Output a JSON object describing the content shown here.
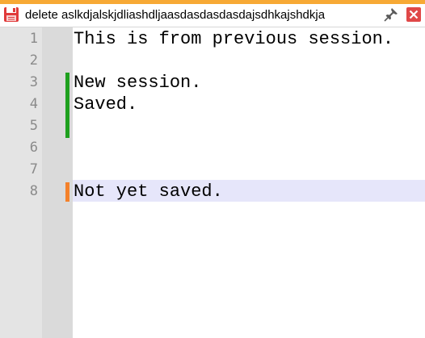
{
  "tab": {
    "title": "delete aslkdjalskjdliashdljaasdasdasdasdajsdhkajshdkja",
    "accent_color": "#f7a935",
    "icons": {
      "save": "floppy-disk-icon",
      "pin": "pin-icon",
      "close": "close-icon"
    }
  },
  "editor": {
    "lines": [
      {
        "number": "1",
        "text": "This is from previous session."
      },
      {
        "number": "2",
        "text": ""
      },
      {
        "number": "3",
        "text": "New session."
      },
      {
        "number": "4",
        "text": "Saved."
      },
      {
        "number": "5",
        "text": ""
      },
      {
        "number": "6",
        "text": ""
      },
      {
        "number": "7",
        "text": ""
      },
      {
        "number": "8",
        "text": "Not yet saved."
      }
    ],
    "current_line": 8,
    "change_history": {
      "saved_lines": [
        3,
        4,
        5
      ],
      "unsaved_lines": [
        8
      ],
      "saved_color": "#1ea01e",
      "unsaved_color": "#f4812a"
    },
    "current_line_color": "#e6e6fa"
  }
}
